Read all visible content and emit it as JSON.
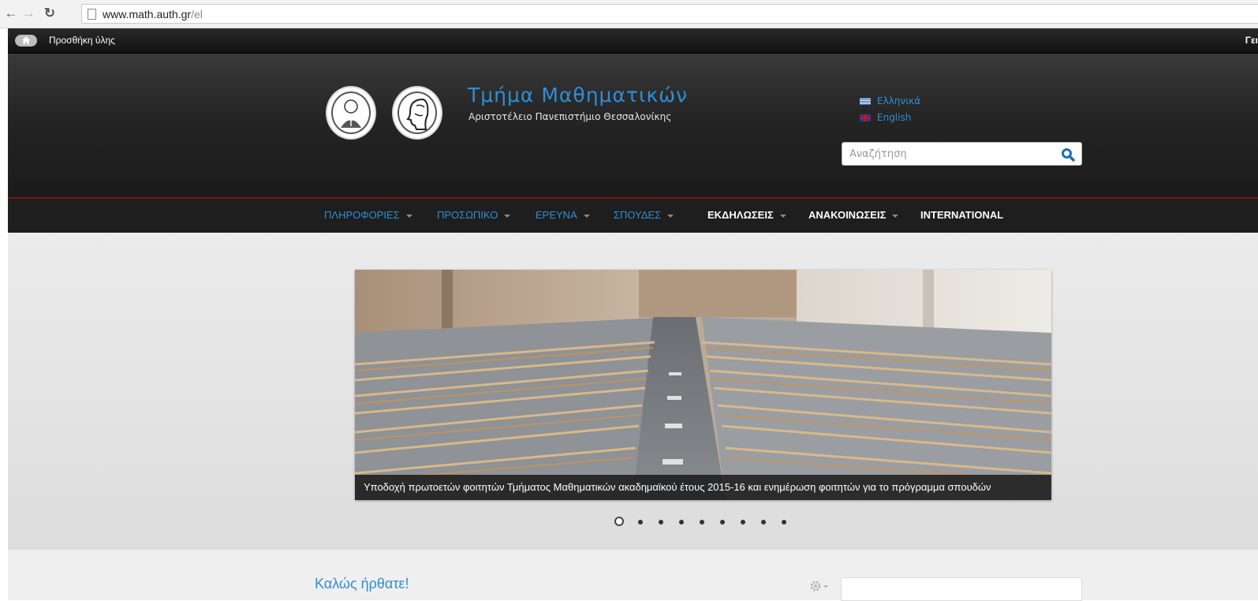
{
  "browser": {
    "url_domain": "www.math.auth.gr",
    "url_path": "/el"
  },
  "admin_bar": {
    "add_content_label": "Προσθήκη ύλης",
    "greeting": "Γει"
  },
  "header": {
    "title": "Τμήμα Μαθηματικών",
    "subtitle": "Αριστοτέλειο Πανεπιστήμιο Θεσσαλονίκης",
    "languages": [
      {
        "label": "Ελληνικά",
        "flag": "greek-flag-icon"
      },
      {
        "label": "English",
        "flag": "uk-flag-icon"
      }
    ],
    "search_placeholder": "Αναζήτηση"
  },
  "nav": {
    "items": [
      {
        "label": "ΠΛΗΡΟΦΟΡΙΕΣ",
        "dropdown": true
      },
      {
        "label": "ΠΡΟΣΩΠΙΚΟ",
        "dropdown": true
      },
      {
        "label": "ΕΡΕΥΝΑ",
        "dropdown": true
      },
      {
        "label": "ΣΠΟΥΔΕΣ",
        "dropdown": true
      },
      {
        "label": "ΕΚΔΗΛΩΣΕΙΣ",
        "dropdown": true
      },
      {
        "label": "ΑΝΑΚΟΙΝΩΣΕΙΣ",
        "dropdown": true
      },
      {
        "label": "INTERNATIONAL",
        "dropdown": false
      }
    ]
  },
  "slider": {
    "caption": "Υποδοχή πρωτοετών φοιτητών Τμήματος Μαθηματικών ακαδημαϊκού έτους 2015-16 και ενημέρωση φοιτητών για το πρόγραμμα σπουδών",
    "dot_count": 9,
    "active_dot": 1
  },
  "content": {
    "welcome_title": "Καλώς ήρθατε!"
  },
  "colors": {
    "link_blue": "#2f8ed7",
    "header_dark": "#1b1b1b",
    "nav_accent_red": "#7a1616"
  }
}
